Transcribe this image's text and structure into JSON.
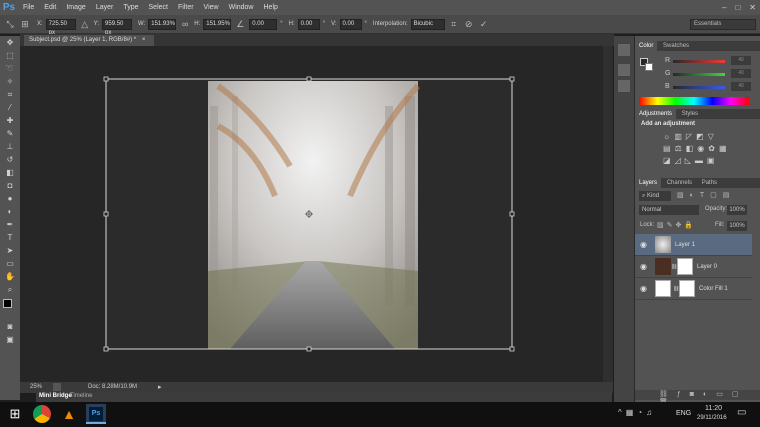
{
  "app": {
    "logo": "Ps"
  },
  "menu": [
    "File",
    "Edit",
    "Image",
    "Layer",
    "Type",
    "Select",
    "Filter",
    "View",
    "Window",
    "Help"
  ],
  "window_controls": [
    "–",
    "□",
    "✕"
  ],
  "options": {
    "x_label": "X:",
    "x_value": "725.50 px",
    "y_label": "Y:",
    "y_value": "959.50 px",
    "w_label": "W:",
    "w_value": "151.93%",
    "h_label": "H:",
    "h_value": "151.95%",
    "angle_value": "0.00",
    "angle_unit": "°",
    "hskew_label": "H:",
    "hskew_value": "0.00",
    "hskew_unit": "°",
    "vskew_label": "V:",
    "vskew_value": "0.00",
    "vskew_unit": "°",
    "interp_label": "Interpolation:",
    "interp_value": "Bicubic",
    "workspace": "Essentials"
  },
  "document": {
    "tab_title": "Subject.psd @ 25% (Layer 1, RGB/8#) *",
    "tab_close": "×"
  },
  "status": {
    "zoom": "25%",
    "doc": "Doc: 8.28M/10.9M"
  },
  "bottom_tabs": [
    "Mini Bridge",
    "Timeline"
  ],
  "color_panel": {
    "tabs": [
      "Color",
      "Swatches"
    ],
    "channels": [
      {
        "label": "R",
        "value": "40"
      },
      {
        "label": "G",
        "value": "40"
      },
      {
        "label": "B",
        "value": "40"
      }
    ]
  },
  "adjustments_panel": {
    "tabs": [
      "Adjustments",
      "Styles"
    ],
    "heading": "Add an adjustment"
  },
  "layers_panel": {
    "tabs": [
      "Layers",
      "Channels",
      "Paths"
    ],
    "kind": "Kind",
    "blend_mode": "Normal",
    "opacity_label": "Opacity:",
    "opacity_value": "100%",
    "lock_label": "Lock:",
    "fill_label": "Fill:",
    "fill_value": "100%",
    "layers": [
      {
        "name": "Layer 1"
      },
      {
        "name": "Layer 0"
      },
      {
        "name": "Color Fill 1"
      }
    ]
  },
  "taskbar": {
    "lang": "ENG",
    "time": "11:20",
    "date": "29/11/2016"
  },
  "colors": {
    "accent": "#4fa3e8",
    "panel": "#535353",
    "selected_layer": "#5a6a80"
  }
}
